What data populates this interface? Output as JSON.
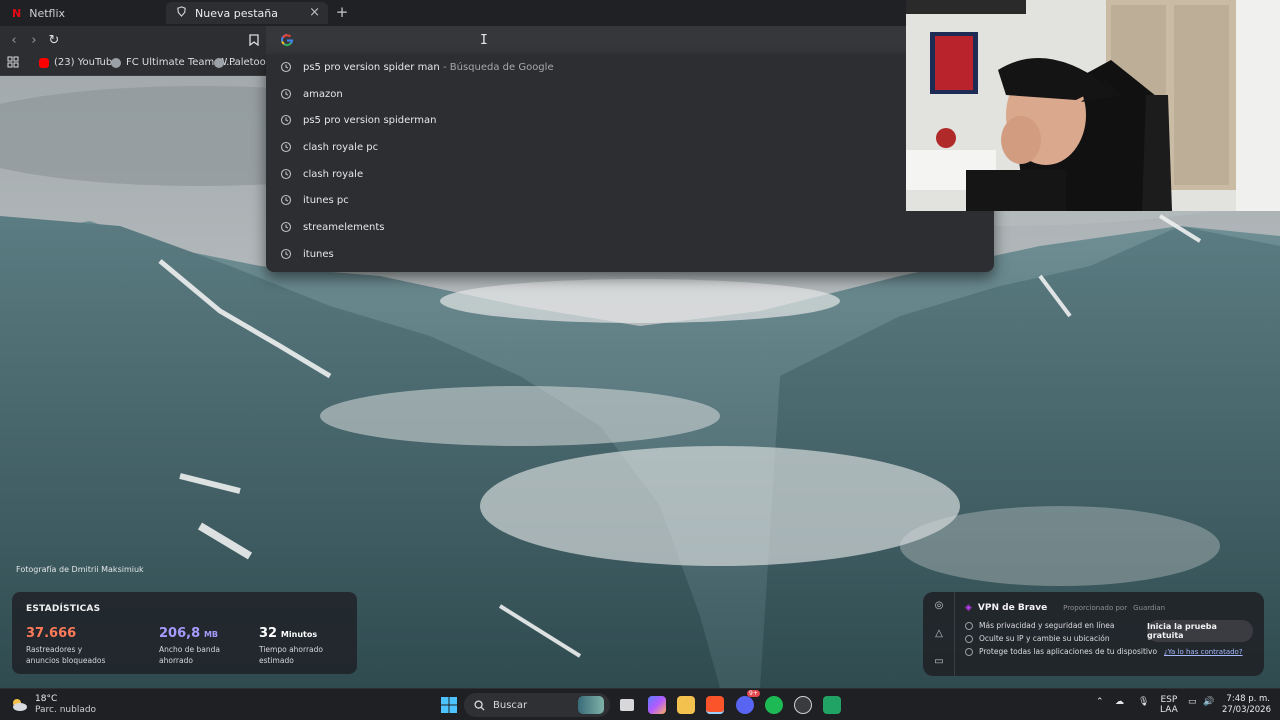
{
  "tabs": [
    {
      "title": "Netflix",
      "icon": "netflix-icon",
      "active": false
    },
    {
      "title": "Nueva pestaña",
      "icon": "brave-shield-icon",
      "active": true
    }
  ],
  "toolbar": {
    "back": "‹",
    "forward": "›",
    "reload": "↻",
    "bookmark": "bookmark-icon",
    "omnibox_icon": "google-icon",
    "omnibox_value": ""
  },
  "bookmarks": [
    {
      "label": "(23) YouTube",
      "icon": "youtube-icon",
      "color": "#ff0000"
    },
    {
      "label": "FC Ultimate Team W...",
      "icon": "globe-icon",
      "color": "#9aa0a6"
    },
    {
      "label": "Paletools v",
      "icon": "globe-icon",
      "color": "#9aa0a6"
    }
  ],
  "suggestions": [
    {
      "text": "ps5 pro version spider man",
      "sub": " - Búsqueda de Google"
    },
    {
      "text": "amazon",
      "sub": ""
    },
    {
      "text": "ps5 pro version spiderman",
      "sub": ""
    },
    {
      "text": "clash royale pc",
      "sub": ""
    },
    {
      "text": "clash royale",
      "sub": ""
    },
    {
      "text": "itunes pc",
      "sub": ""
    },
    {
      "text": "streamelements",
      "sub": ""
    },
    {
      "text": "itunes",
      "sub": ""
    }
  ],
  "photo_credit": "Fotografía de Dmitrii Maksimiuk",
  "stats": {
    "title": "ESTADÍSTICAS",
    "trackers": {
      "value": "37.666",
      "label": "Rastreadores y anuncios bloqueados",
      "color": "#ff7a59"
    },
    "bandwidth": {
      "value": "206,8",
      "unit": "MB",
      "label": "Ancho de banda ahorrado",
      "color": "#a49cff"
    },
    "time": {
      "value": "32",
      "unit": "Minutos",
      "label": "Tiempo ahorrado estimado",
      "color": "#ffffff"
    }
  },
  "vpn": {
    "title": "VPN de Brave",
    "provided_by": "Proporcionado por",
    "provider": "Guardian",
    "features": [
      "Más privacidad y seguridad en línea",
      "Oculte su IP y cambie su ubicación",
      "Protege todas las aplicaciones de tu dispositivo"
    ],
    "cta": "Inicia la prueba gratuita",
    "link": "¿Ya lo has contratado?"
  },
  "taskbar": {
    "temperature": "18°C",
    "weather": "Parc. nublado",
    "search_placeholder": "Buscar",
    "lang_top": "ESP",
    "lang_bottom": "LAA",
    "time": "7:48 p. m.",
    "date": "27/03/2026",
    "discord_badge": "9+"
  }
}
